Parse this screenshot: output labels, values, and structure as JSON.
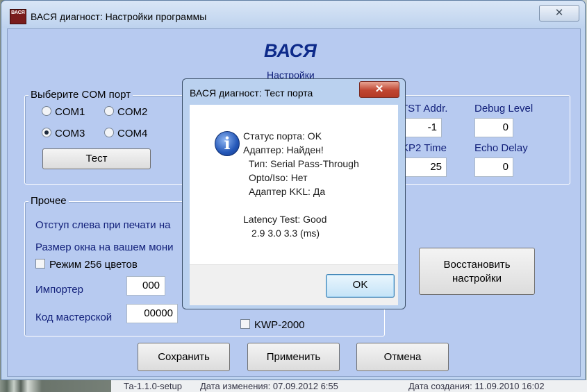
{
  "window": {
    "title": "ВАСЯ диагност: Настройки программы",
    "icon_text": "ВАСЯ",
    "close_glyph": "✕"
  },
  "header": {
    "app_name": "ВАСЯ",
    "subtitle": "Настройки"
  },
  "com_group": {
    "label": "Выберите COM порт",
    "options": [
      "COM1",
      "COM2",
      "COM3",
      "COM4"
    ],
    "selected": "COM3",
    "test_button": "Тест"
  },
  "timing": {
    "tst_addr_label": "TST Addr.",
    "tst_addr_value": "-1",
    "debug_level_label": "Debug Level",
    "debug_level_value": "0",
    "kp2_time_label": "KP2 Time",
    "kp2_time_value": "25",
    "echo_delay_label": "Echo Delay",
    "echo_delay_value": "0"
  },
  "other_group": {
    "label": "Прочее",
    "print_indent_label": "Отступ слева при печати на",
    "window_size_label": "Размер окна на вашем мони",
    "mode256_label": "Режим 256 цветов",
    "importer_label": "Импортер",
    "importer_value": "000",
    "shop_code_label": "Код мастерской",
    "shop_code_value": "00000",
    "kwp_label": "KWP-2000"
  },
  "restore_button": "Восстановить настройки",
  "footer_buttons": {
    "save": "Сохранить",
    "apply": "Применить",
    "cancel": "Отмена"
  },
  "dialog": {
    "title": "ВАСЯ диагност: Тест порта",
    "close_glyph": "✕",
    "icon_glyph": "i",
    "lines": [
      "Статус порта: OK",
      "Адаптер: Найден!",
      "  Тип: Serial Pass-Through",
      "  Opto/Iso: Нет",
      "  Адаптер KKL: Да",
      "",
      "Latency Test: Good",
      "   2.9  3.0  3.3 (ms)"
    ],
    "ok_button": "OK"
  },
  "background_strip": {
    "item1": "Та-1.1.0-setup",
    "item2": "Дата изменения: 07.09.2012 6:55",
    "item3": "Дата создания: 11.09.2010 16:02"
  }
}
